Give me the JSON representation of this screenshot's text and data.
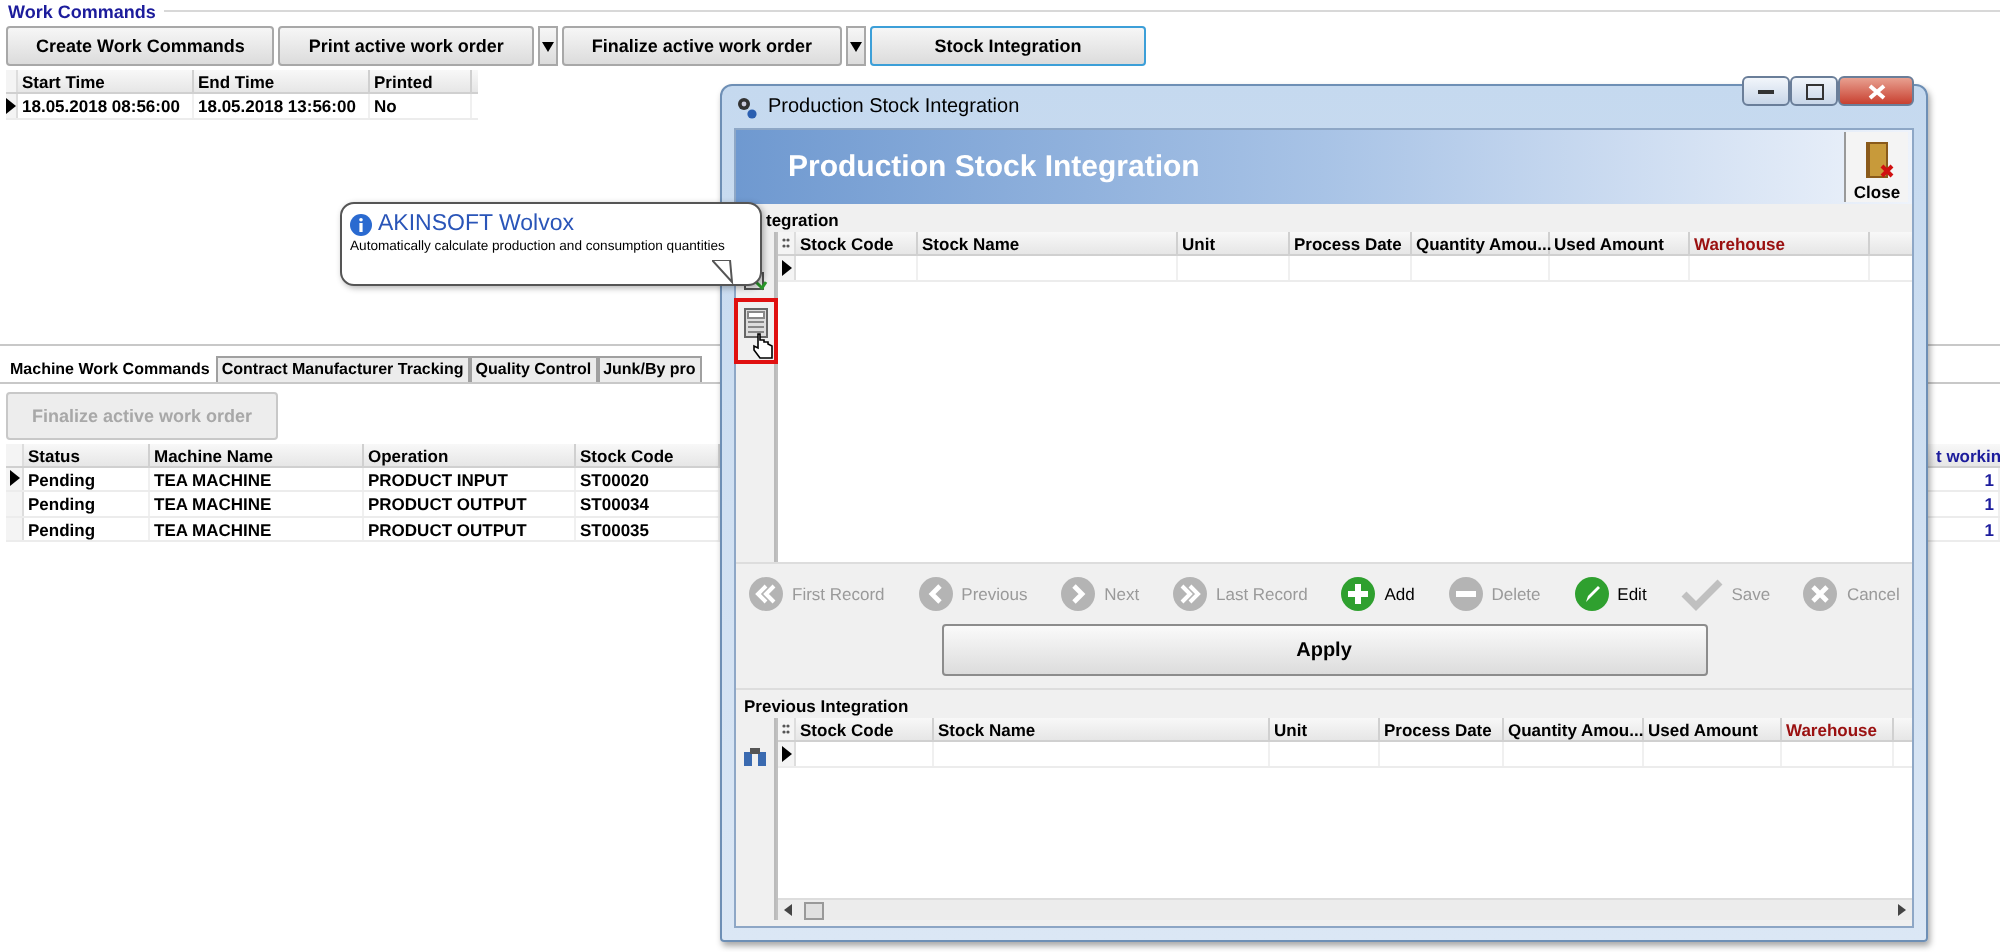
{
  "main": {
    "title": "Work Commands",
    "toolbar": [
      {
        "label": "Create Work Commands",
        "dropdown": false,
        "focused": false
      },
      {
        "label": "Print active work order",
        "dropdown": true,
        "focused": false
      },
      {
        "label": "Finalize active work order",
        "dropdown": true,
        "focused": false
      },
      {
        "label": "Stock Integration",
        "dropdown": false,
        "focused": true
      }
    ],
    "orders": {
      "columns": [
        "Start Time",
        "End Time",
        "Printed"
      ],
      "rows": [
        {
          "current": true,
          "cells": [
            "18.05.2018 08:56:00",
            "18.05.2018 13:56:00",
            "No"
          ]
        }
      ]
    },
    "tabs": [
      {
        "label": "Machine Work Commands",
        "selected": true
      },
      {
        "label": "Contract Manufacturer Tracking",
        "selected": false
      },
      {
        "label": "Quality Control",
        "selected": false
      },
      {
        "label": "Junk/By pro",
        "selected": false
      }
    ],
    "finalize_button": {
      "label": "Finalize active work order",
      "disabled": true
    },
    "machines": {
      "columns": [
        "Status",
        "Machine Name",
        "Operation",
        "Stock Code",
        "t workin"
      ],
      "rows": [
        {
          "current": true,
          "cells": [
            "Pending",
            "TEA MACHINE",
            "PRODUCT INPUT",
            "ST00020",
            "1"
          ]
        },
        {
          "current": false,
          "cells": [
            "Pending",
            "TEA MACHINE",
            "PRODUCT OUTPUT",
            "ST00034",
            "1"
          ]
        },
        {
          "current": false,
          "cells": [
            "Pending",
            "TEA MACHINE",
            "PRODUCT OUTPUT",
            "ST00035",
            "1"
          ]
        }
      ]
    }
  },
  "dialog": {
    "window_title": "Production Stock Integration",
    "banner_title": "Production Stock Integration",
    "close_label": "Close",
    "integration": {
      "label": "tegration",
      "highlighted_tool": true,
      "columns": [
        {
          "label": "Stock Code",
          "color": "#000000"
        },
        {
          "label": "Stock Name",
          "color": "#000000"
        },
        {
          "label": "Unit",
          "color": "#000000"
        },
        {
          "label": "Process Date",
          "color": "#000000"
        },
        {
          "label": "Quantity Amou...",
          "color": "#000000"
        },
        {
          "label": "Used Amount",
          "color": "#000000"
        },
        {
          "label": "Warehouse",
          "color": "#9a1010"
        }
      ]
    },
    "navigator": [
      {
        "kind": "first",
        "label": "First Record",
        "disabled": true
      },
      {
        "kind": "prev",
        "label": "Previous",
        "disabled": true
      },
      {
        "kind": "next",
        "label": "Next",
        "disabled": true
      },
      {
        "kind": "last",
        "label": "Last Record",
        "disabled": true
      },
      {
        "kind": "add",
        "label": "Add",
        "disabled": false
      },
      {
        "kind": "delete",
        "label": "Delete",
        "disabled": true
      },
      {
        "kind": "edit",
        "label": "Edit",
        "disabled": false
      },
      {
        "kind": "save",
        "label": "Save",
        "disabled": true
      },
      {
        "kind": "cancel",
        "label": "Cancel",
        "disabled": true
      }
    ],
    "apply_label": "Apply",
    "previous": {
      "label": "Previous Integration",
      "columns": [
        {
          "label": "Stock Code",
          "color": "#000000"
        },
        {
          "label": "Stock Name",
          "color": "#000000"
        },
        {
          "label": "Unit",
          "color": "#000000"
        },
        {
          "label": "Process Date",
          "color": "#000000"
        },
        {
          "label": "Quantity Amou...",
          "color": "#000000"
        },
        {
          "label": "Used Amount",
          "color": "#000000"
        },
        {
          "label": "Warehouse",
          "color": "#9a1010"
        }
      ]
    }
  },
  "tooltip": {
    "title": "AKINSOFT Wolvox",
    "text": "Automatically calculate production and consumption quantities"
  }
}
